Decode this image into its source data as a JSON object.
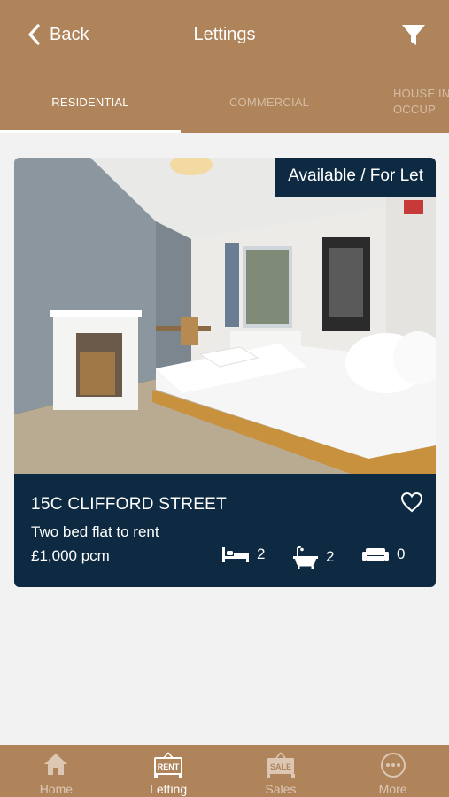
{
  "header": {
    "back_label": "Back",
    "title": "Lettings"
  },
  "tabs": [
    {
      "label": "RESIDENTIAL",
      "active": true
    },
    {
      "label": "COMMERCIAL",
      "active": false
    },
    {
      "label": "HOUSE IN\nOCCUP",
      "active": false
    }
  ],
  "listing": {
    "badge": "Available / For Let",
    "address": "15C CLIFFORD STREET",
    "description": "Two bed flat to rent",
    "price": "£1,000 pcm",
    "bedrooms": "2",
    "bathrooms": "2",
    "receptions": "0"
  },
  "bottom_nav": [
    {
      "label": "Home",
      "icon": "home-icon",
      "active": false
    },
    {
      "label": "Letting",
      "icon": "rent-sign-icon",
      "icon_text": "RENT",
      "active": true
    },
    {
      "label": "Sales",
      "icon": "sale-sign-icon",
      "icon_text": "SALE",
      "active": false
    },
    {
      "label": "More",
      "icon": "more-icon",
      "active": false
    }
  ],
  "colors": {
    "brand": "#b0845a",
    "card": "#0e2a42",
    "background": "#f2f2f2"
  }
}
